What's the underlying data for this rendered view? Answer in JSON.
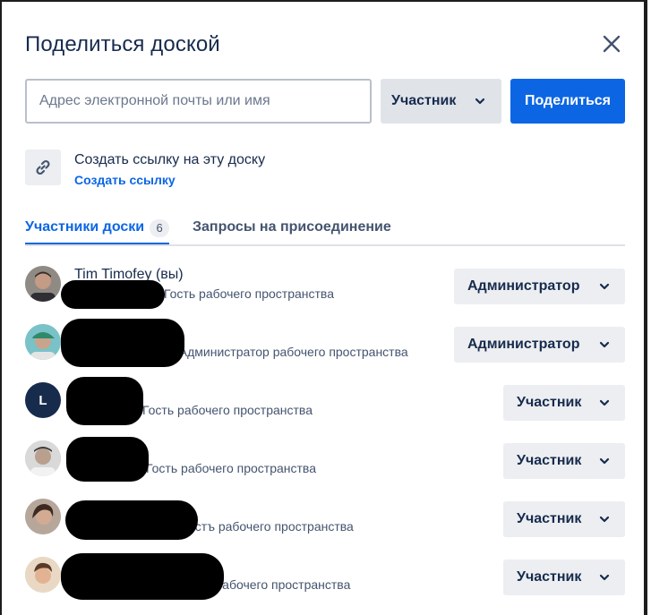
{
  "dialog": {
    "title": "Поделиться доской",
    "close_icon": "close-icon"
  },
  "invite": {
    "placeholder": "Адрес электронной почты или имя",
    "role_label": "Участник",
    "share_label": "Поделиться"
  },
  "link": {
    "icon": "link-icon",
    "title": "Создать ссылку на эту доску",
    "action": "Создать ссылку"
  },
  "tabs": {
    "members_label": "Участники доски",
    "members_count": "6",
    "requests_label": "Запросы на присоединение"
  },
  "members": [
    {
      "name": "Tim Timofey (вы)",
      "role": "Гость рабочего пространства",
      "permission": "Администратор",
      "avatar": "photo"
    },
    {
      "name": "",
      "role": "• Администратор рабочего пространства",
      "permission": "Администратор",
      "avatar": "photo"
    },
    {
      "name": "",
      "role": "Гость рабочего пространства",
      "permission": "Участник",
      "avatar": "L"
    },
    {
      "name": "",
      "role": "Гость рабочего пространства",
      "permission": "Участник",
      "avatar": "photo"
    },
    {
      "name": "",
      "role": "остъ рабочего пространства",
      "permission": "Участник",
      "avatar": "photo"
    },
    {
      "name": "",
      "role": "ость рабочего пространства",
      "permission": "Участник",
      "avatar": "photo"
    }
  ],
  "colors": {
    "primary": "#0c66e4",
    "text": "#172b4d",
    "subtle_bg": "#eceef1"
  }
}
